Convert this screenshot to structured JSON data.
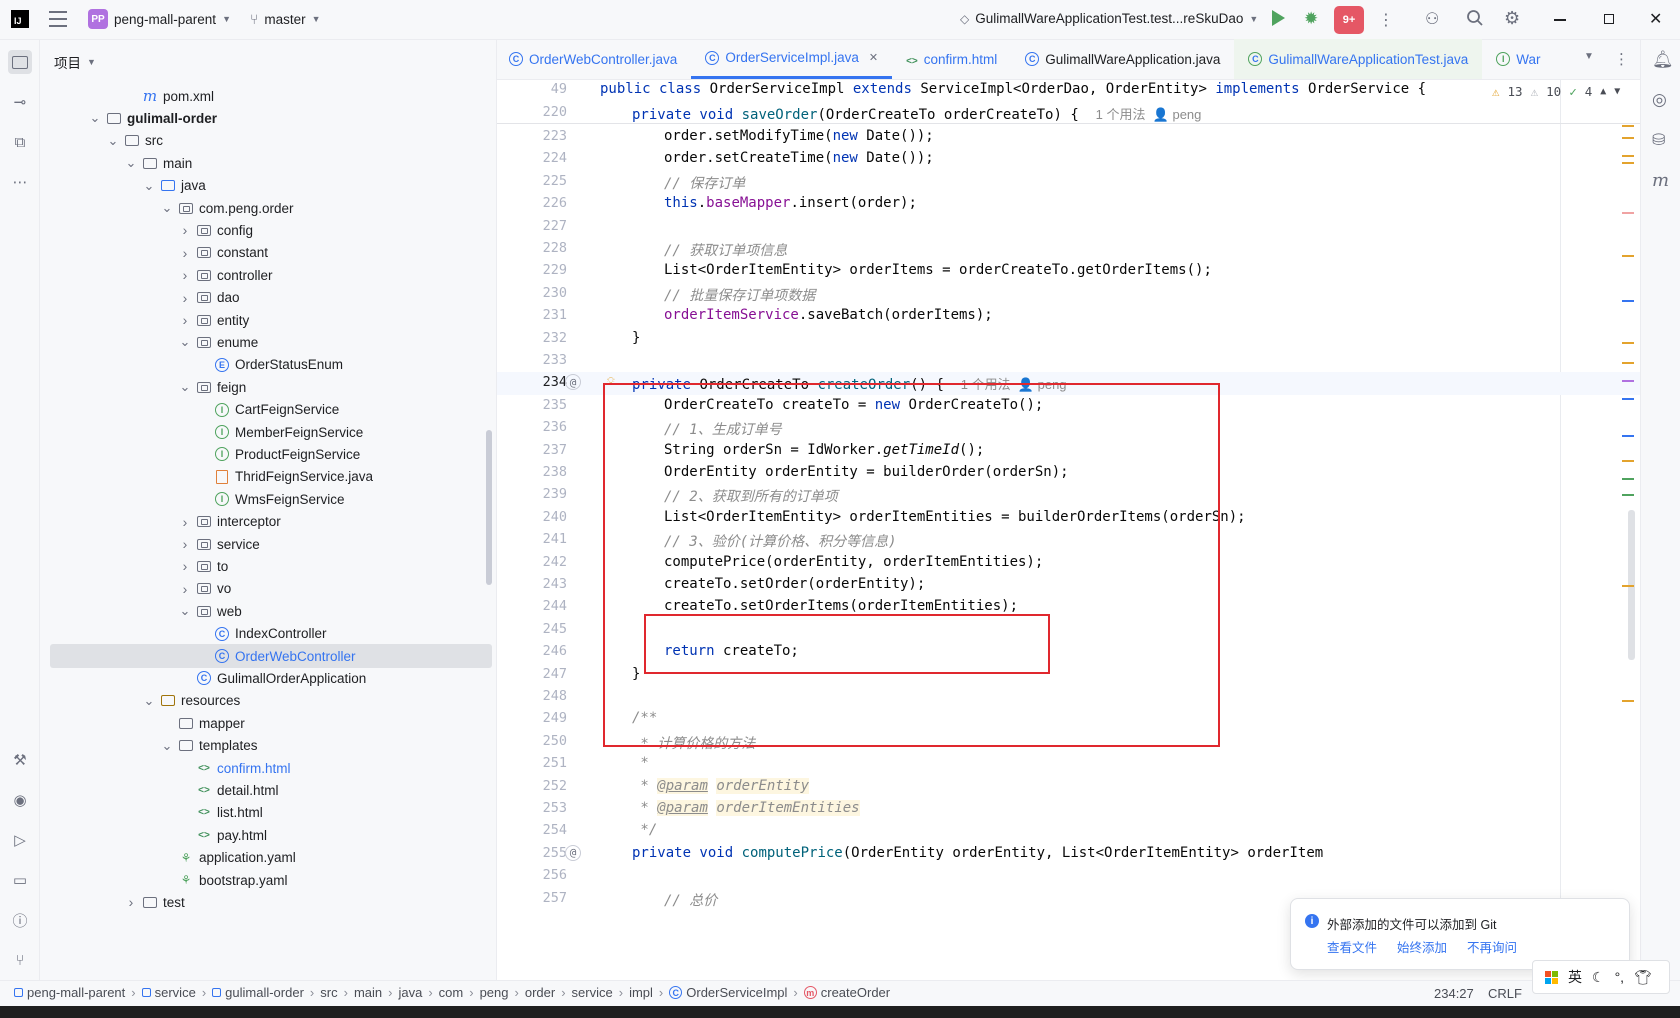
{
  "titlebar": {
    "project_badge": "PP",
    "project_name": "peng-mall-parent",
    "branch": "master",
    "run_config": "GulimallWareApplicationTest.test...reSkuDao",
    "notif_count": "9+"
  },
  "project_panel": {
    "title": "项目",
    "tree": [
      {
        "label": "pom.xml",
        "indent": 4,
        "icon": "maven-icon",
        "chev": ""
      },
      {
        "label": "gulimall-order",
        "indent": 2,
        "icon": "module-folder-icon",
        "chev": "open",
        "bold": true
      },
      {
        "label": "src",
        "indent": 3,
        "icon": "folder-icon",
        "chev": "open"
      },
      {
        "label": "main",
        "indent": 4,
        "icon": "folder-icon",
        "chev": "open"
      },
      {
        "label": "java",
        "indent": 5,
        "icon": "source-folder-icon",
        "chev": "open"
      },
      {
        "label": "com.peng.order",
        "indent": 6,
        "icon": "package-icon",
        "chev": "open"
      },
      {
        "label": "config",
        "indent": 7,
        "icon": "package-icon",
        "chev": "closed"
      },
      {
        "label": "constant",
        "indent": 7,
        "icon": "package-icon",
        "chev": "closed"
      },
      {
        "label": "controller",
        "indent": 7,
        "icon": "package-icon",
        "chev": "closed"
      },
      {
        "label": "dao",
        "indent": 7,
        "icon": "package-icon",
        "chev": "closed"
      },
      {
        "label": "entity",
        "indent": 7,
        "icon": "package-icon",
        "chev": "closed"
      },
      {
        "label": "enume",
        "indent": 7,
        "icon": "package-icon",
        "chev": "open"
      },
      {
        "label": "OrderStatusEnum",
        "indent": 8,
        "icon": "enum-icon",
        "chev": ""
      },
      {
        "label": "feign",
        "indent": 7,
        "icon": "package-icon",
        "chev": "open"
      },
      {
        "label": "CartFeignService",
        "indent": 8,
        "icon": "interface-icon",
        "chev": ""
      },
      {
        "label": "MemberFeignService",
        "indent": 8,
        "icon": "interface-icon",
        "chev": ""
      },
      {
        "label": "ProductFeignService",
        "indent": 8,
        "icon": "interface-icon",
        "chev": ""
      },
      {
        "label": "ThridFeignService.java",
        "indent": 8,
        "icon": "java-file-icon",
        "chev": ""
      },
      {
        "label": "WmsFeignService",
        "indent": 8,
        "icon": "interface-icon",
        "chev": ""
      },
      {
        "label": "interceptor",
        "indent": 7,
        "icon": "package-icon",
        "chev": "closed"
      },
      {
        "label": "service",
        "indent": 7,
        "icon": "package-icon",
        "chev": "closed"
      },
      {
        "label": "to",
        "indent": 7,
        "icon": "package-icon",
        "chev": "closed"
      },
      {
        "label": "vo",
        "indent": 7,
        "icon": "package-icon",
        "chev": "closed"
      },
      {
        "label": "web",
        "indent": 7,
        "icon": "package-icon",
        "chev": "open"
      },
      {
        "label": "IndexController",
        "indent": 8,
        "icon": "class-icon",
        "chev": ""
      },
      {
        "label": "OrderWebController",
        "indent": 8,
        "icon": "class-icon",
        "chev": "",
        "selected": true
      },
      {
        "label": "GulimallOrderApplication",
        "indent": 7,
        "icon": "spring-class-icon",
        "chev": ""
      },
      {
        "label": "resources",
        "indent": 5,
        "icon": "resources-folder-icon",
        "chev": "open"
      },
      {
        "label": "mapper",
        "indent": 6,
        "icon": "folder-icon",
        "chev": ""
      },
      {
        "label": "templates",
        "indent": 6,
        "icon": "folder-icon",
        "chev": "open"
      },
      {
        "label": "confirm.html",
        "indent": 7,
        "icon": "html-icon",
        "chev": "",
        "modified": true
      },
      {
        "label": "detail.html",
        "indent": 7,
        "icon": "html-icon",
        "chev": ""
      },
      {
        "label": "list.html",
        "indent": 7,
        "icon": "html-icon",
        "chev": ""
      },
      {
        "label": "pay.html",
        "indent": 7,
        "icon": "html-icon",
        "chev": ""
      },
      {
        "label": "application.yaml",
        "indent": 6,
        "icon": "yaml-icon",
        "chev": ""
      },
      {
        "label": "bootstrap.yaml",
        "indent": 6,
        "icon": "yaml-icon",
        "chev": ""
      },
      {
        "label": "test",
        "indent": 4,
        "icon": "folder-icon",
        "chev": "closed"
      }
    ]
  },
  "tabs": [
    {
      "label": "OrderWebController.java",
      "icon": "class-icon"
    },
    {
      "label": "OrderServiceImpl.java",
      "icon": "class-icon",
      "active": true,
      "closable": true
    },
    {
      "label": "confirm.html",
      "icon": "html-icon"
    },
    {
      "label": "GulimallWareApplication.java",
      "icon": "spring-class-icon",
      "plain": true
    },
    {
      "label": "GulimallWareApplicationTest.java",
      "icon": "test-class-icon",
      "shaded": true
    },
    {
      "label": "War",
      "icon": "interface-icon"
    }
  ],
  "inspection": {
    "warnings": "13",
    "weak_warnings": "10",
    "typos": "4"
  },
  "code_lines": [
    {
      "n": "49",
      "html": "<span class='kw'>public class</span> OrderServiceImpl <span class='kw'>extends</span> ServiceImpl&lt;OrderDao, OrderEntity&gt; <span class='kw'>implements</span> OrderService {",
      "indent": 0,
      "sticky": true
    },
    {
      "n": "220",
      "html": "<span class='kw'>private void</span> <span class='fn'>saveOrder</span>(OrderCreateTo orderCreateTo) {  <span class='hint'>1 个用法  👤 peng</span>",
      "indent": 1,
      "sticky": true
    },
    {
      "n": "223",
      "html": "order.setModifyTime(<span class='kw'>new</span> Date());",
      "indent": 2
    },
    {
      "n": "224",
      "html": "order.setCreateTime(<span class='kw'>new</span> Date());",
      "indent": 2
    },
    {
      "n": "225",
      "html": "<span class='cm'>// 保存订单</span>",
      "indent": 2
    },
    {
      "n": "226",
      "html": "<span class='kw'>this</span>.<span class='fld'>baseMapper</span>.insert(order);",
      "indent": 2
    },
    {
      "n": "227",
      "html": "",
      "indent": 2
    },
    {
      "n": "228",
      "html": "<span class='cm'>// 获取订单项信息</span>",
      "indent": 2
    },
    {
      "n": "229",
      "html": "List&lt;OrderItemEntity&gt; orderItems = orderCreateTo.getOrderItems();",
      "indent": 2
    },
    {
      "n": "230",
      "html": "<span class='cm'>// 批量保存订单项数据</span>",
      "indent": 2
    },
    {
      "n": "231",
      "html": "<span class='fld'>orderItemService</span>.saveBatch(orderItems);",
      "indent": 2
    },
    {
      "n": "232",
      "html": "}",
      "indent": 1
    },
    {
      "n": "233",
      "html": "",
      "indent": 1
    },
    {
      "n": "234",
      "html": "<span class='kw'>private</span> OrderCreateTo <span class='fn'>createOrder</span>() {  <span class='hint'>1 个用法  👤 peng</span>",
      "indent": 1,
      "current": true,
      "gutter": "@"
    },
    {
      "n": "235",
      "html": "OrderCreateTo createTo = <span class='kw'>new</span> OrderCreateTo();",
      "indent": 2
    },
    {
      "n": "236",
      "html": "<span class='cm'>// 1、生成订单号</span>",
      "indent": 2
    },
    {
      "n": "237",
      "html": "String orderSn = IdWorker.<span class='it'>getTimeId</span>();",
      "indent": 2
    },
    {
      "n": "238",
      "html": "OrderEntity orderEntity = builderOrder(orderSn);",
      "indent": 2
    },
    {
      "n": "239",
      "html": "<span class='cm'>// 2、获取到所有的订单项</span>",
      "indent": 2
    },
    {
      "n": "240",
      "html": "List&lt;OrderItemEntity&gt; orderItemEntities = builderOrderItems(orderSn);",
      "indent": 2
    },
    {
      "n": "241",
      "html": "<span class='cm'>// 3、验价(计算价格、积分等信息)</span>",
      "indent": 2
    },
    {
      "n": "242",
      "html": "computePrice(orderEntity, orderItemEntities);",
      "indent": 2
    },
    {
      "n": "243",
      "html": "createTo.setOrder(orderEntity);",
      "indent": 2
    },
    {
      "n": "244",
      "html": "createTo.setOrderItems(orderItemEntities);",
      "indent": 2
    },
    {
      "n": "245",
      "html": "",
      "indent": 2
    },
    {
      "n": "246",
      "html": "<span class='kw'>return</span> createTo;",
      "indent": 2
    },
    {
      "n": "247",
      "html": "}",
      "indent": 1
    },
    {
      "n": "248",
      "html": "",
      "indent": 1
    },
    {
      "n": "249",
      "html": "<span class='cm'>/**</span>",
      "indent": 1
    },
    {
      "n": "250",
      "html": "<span class='cm'> * 计算价格的方法</span>",
      "indent": 1
    },
    {
      "n": "251",
      "html": "<span class='cm'> *</span>",
      "indent": 1
    },
    {
      "n": "252",
      "html": "<span class='cm'> * </span><span class='jdtag'>@param</span> <span class='jdval'>orderEntity</span>",
      "indent": 1
    },
    {
      "n": "253",
      "html": "<span class='cm'> * </span><span class='jdtag'>@param</span> <span class='jdval'>orderItemEntities</span>",
      "indent": 1
    },
    {
      "n": "254",
      "html": "<span class='cm'> */</span>",
      "indent": 1
    },
    {
      "n": "255",
      "html": "<span class='kw'>private void</span> <span class='fn'>computePrice</span>(OrderEntity orderEntity, List&lt;OrderItemEntity&gt; orderItem",
      "indent": 1,
      "gutter": "@"
    },
    {
      "n": "256",
      "html": "",
      "indent": 1
    },
    {
      "n": "257",
      "html": "<span class='cm'>// 总价</span>",
      "indent": 2
    }
  ],
  "notification": {
    "message": "外部添加的文件可以添加到 Git",
    "actions": [
      "查看文件",
      "始终添加",
      "不再询问"
    ]
  },
  "statusbar": {
    "breadcrumb": [
      "peng-mall-parent",
      "service",
      "gulimall-order",
      "src",
      "main",
      "java",
      "com",
      "peng",
      "order",
      "service",
      "impl",
      "OrderServiceImpl",
      "createOrder"
    ],
    "position": "234:27",
    "line_sep": "CRLF"
  },
  "ime": {
    "lang": "英"
  }
}
